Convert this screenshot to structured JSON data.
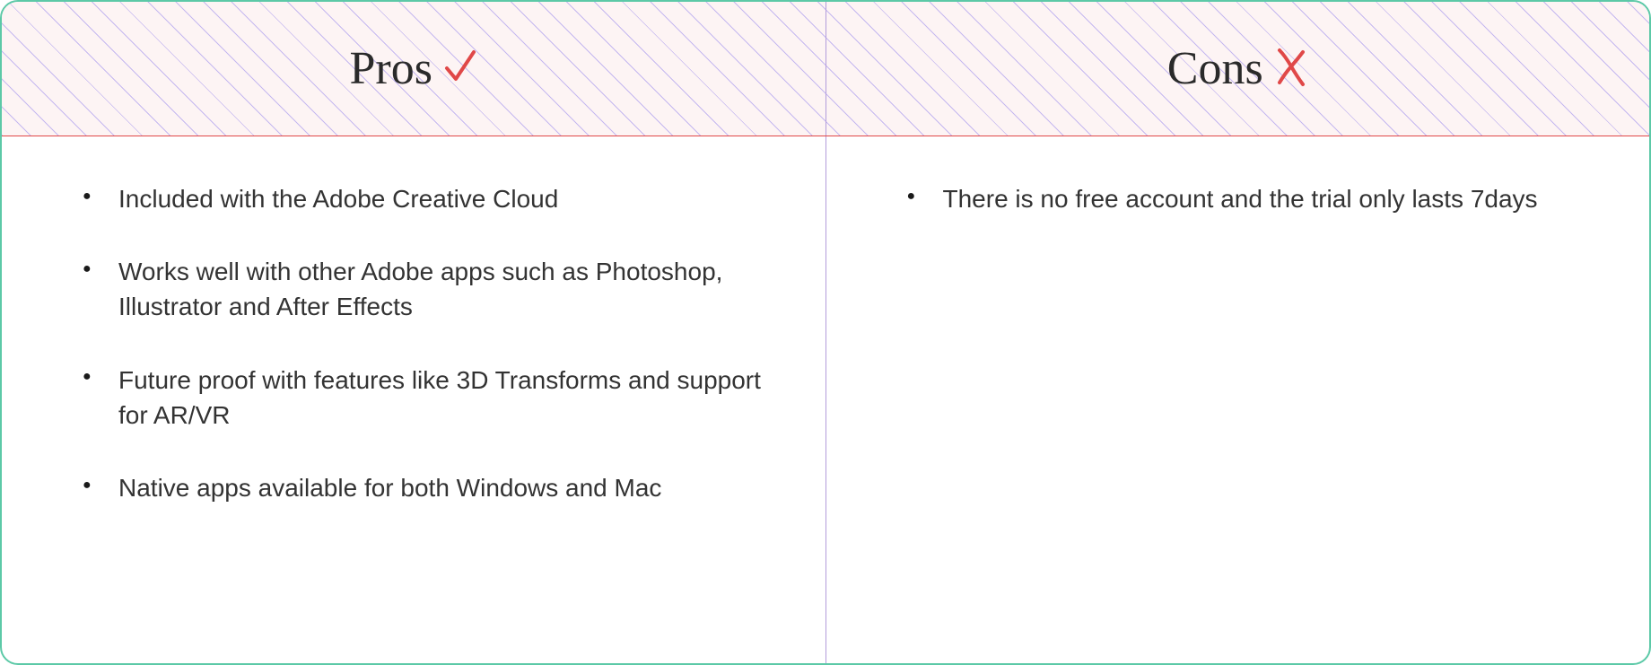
{
  "pros": {
    "title": "Pros",
    "items": [
      "Included with the Adobe Creative Cloud",
      "Works well with other Adobe apps such as Photoshop, Illustrator and After Effects",
      "Future proof with features like 3D Transforms and support for AR/VR",
      "Native apps available for both Windows and Mac"
    ]
  },
  "cons": {
    "title": "Cons",
    "items": [
      "There is no free account and the trial only lasts 7days"
    ]
  }
}
